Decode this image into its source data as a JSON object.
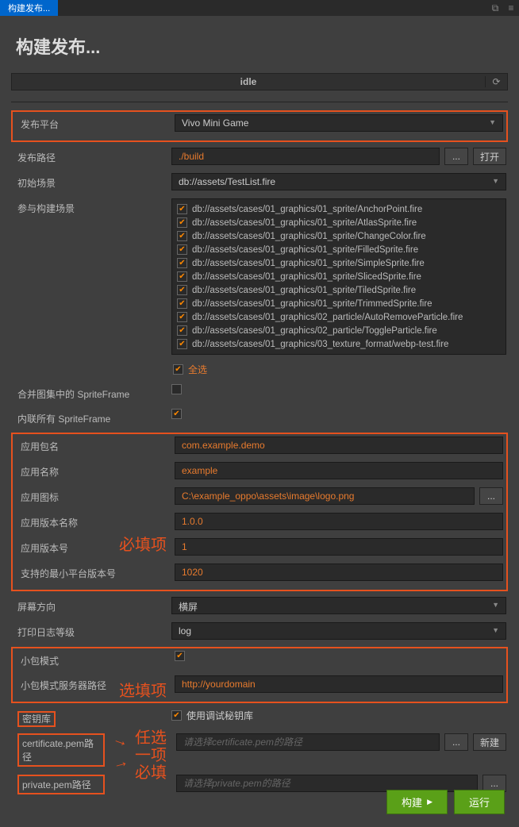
{
  "titlebar": {
    "tab": "构建发布..."
  },
  "pageTitle": "构建发布...",
  "status": {
    "text": "idle"
  },
  "form": {
    "platform": {
      "label": "发布平台",
      "value": "Vivo Mini Game"
    },
    "buildPath": {
      "label": "发布路径",
      "value": "./build",
      "browse": "...",
      "open": "打开"
    },
    "initScene": {
      "label": "初始场景",
      "value": "db://assets/TestList.fire"
    },
    "scenes": {
      "label": "参与构建场景",
      "items": [
        "db://assets/cases/01_graphics/01_sprite/AnchorPoint.fire",
        "db://assets/cases/01_graphics/01_sprite/AtlasSprite.fire",
        "db://assets/cases/01_graphics/01_sprite/ChangeColor.fire",
        "db://assets/cases/01_graphics/01_sprite/FilledSprite.fire",
        "db://assets/cases/01_graphics/01_sprite/SimpleSprite.fire",
        "db://assets/cases/01_graphics/01_sprite/SlicedSprite.fire",
        "db://assets/cases/01_graphics/01_sprite/TiledSprite.fire",
        "db://assets/cases/01_graphics/01_sprite/TrimmedSprite.fire",
        "db://assets/cases/01_graphics/02_particle/AutoRemoveParticle.fire",
        "db://assets/cases/01_graphics/02_particle/ToggleParticle.fire",
        "db://assets/cases/01_graphics/03_texture_format/webp-test.fire"
      ],
      "selectAll": "全选"
    },
    "mergeAtlas": {
      "label": "合并图集中的 SpriteFrame"
    },
    "inlineSF": {
      "label": "内联所有 SpriteFrame"
    },
    "pkgName": {
      "label": "应用包名",
      "value": "com.example.demo"
    },
    "appName": {
      "label": "应用名称",
      "value": "example"
    },
    "appIcon": {
      "label": "应用图标",
      "value": "C:\\example_oppo\\assets\\image\\logo.png",
      "browse": "..."
    },
    "verName": {
      "label": "应用版本名称",
      "value": "1.0.0"
    },
    "verCode": {
      "label": "应用版本号",
      "value": "1"
    },
    "minPlatform": {
      "label": "支持的最小平台版本号",
      "value": "1020"
    },
    "orientation": {
      "label": "屏幕方向",
      "value": "横屏"
    },
    "logLevel": {
      "label": "打印日志等级",
      "value": "log"
    },
    "smallPkg": {
      "label": "小包模式"
    },
    "smallPkgServer": {
      "label": "小包模式服务器路径",
      "value": "http://yourdomain"
    },
    "keystore": {
      "label": "密钥库",
      "useDebug": "使用调试秘钥库"
    },
    "certPem": {
      "label": "certificate.pem路径",
      "placeholder": "请选择certificate.pem的路径",
      "browse": "...",
      "new": "新建"
    },
    "privPem": {
      "label": "private.pem路径",
      "placeholder": "请选择private.pem的路径",
      "browse": "..."
    }
  },
  "annotations": {
    "required": "必填项",
    "optional": "选填项",
    "anyone": "任选",
    "oneof": "一项",
    "must": "必填"
  },
  "footer": {
    "build": "构建",
    "run": "运行"
  }
}
